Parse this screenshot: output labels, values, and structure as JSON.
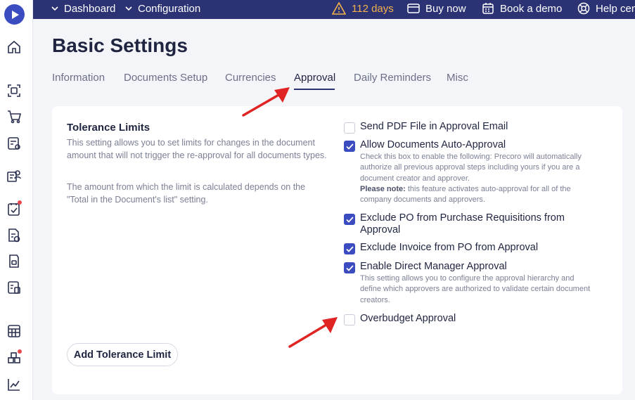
{
  "topbar": {
    "nav": [
      {
        "label": "Dashboard"
      },
      {
        "label": "Configuration"
      }
    ],
    "trial": "112 days",
    "buy_now": "Buy now",
    "book_demo": "Book a demo",
    "help": "Help cen"
  },
  "page": {
    "title": "Basic Settings"
  },
  "tabs": [
    {
      "label": "Information"
    },
    {
      "label": "Documents Setup"
    },
    {
      "label": "Currencies"
    },
    {
      "label": "Approval",
      "active": true
    },
    {
      "label": "Daily Reminders"
    },
    {
      "label": "Misc"
    }
  ],
  "tolerance": {
    "title": "Tolerance Limits",
    "desc1": "This setting allows you to set limits for changes in the document amount that will not trigger the re-approval for all documents types.",
    "desc2": "The amount from which the limit is calculated depends on the \"Total in the Document's list\" setting.",
    "add_button": "Add Tolerance Limit"
  },
  "options": [
    {
      "label": "Send PDF File in Approval Email",
      "checked": false
    },
    {
      "label": "Allow Documents Auto-Approval",
      "checked": true,
      "desc": "Check this box to enable the following: Precoro will automatically authorize all previous approval steps including yours if you are a document creator and approver.",
      "note_label": "Please note:",
      "note": "this feature activates auto-approval for all of the company documents and approvers."
    },
    {
      "label": "Exclude PO from Purchase Requisitions from Approval",
      "checked": true
    },
    {
      "label": "Exclude Invoice from PO from Approval",
      "checked": true
    },
    {
      "label": "Enable Direct Manager Approval",
      "checked": true,
      "desc": "This setting allows you to configure the approval hierarchy and define which approvers are authorized to validate certain document creators."
    },
    {
      "label": "Overbudget Approval",
      "checked": false
    }
  ],
  "colors": {
    "accent": "#3b4cc0",
    "topbar": "#2b3375",
    "arrow": "#e02424",
    "trial": "#f3b14c"
  },
  "icons": {
    "sidebar": [
      "home-icon",
      "scan-icon",
      "cart-icon",
      "request-icon",
      "suppliers-icon",
      "approvals-icon",
      "invoice-icon",
      "receipt-icon",
      "budget-icon",
      "calculator-icon",
      "inventory-icon",
      "analytics-icon"
    ]
  }
}
